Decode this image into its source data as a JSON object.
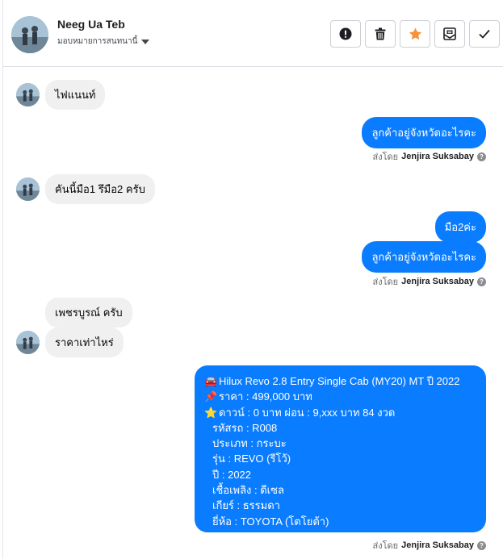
{
  "header": {
    "contact_name": "Neeg Ua Teb",
    "assign_label": "มอบหมายการสนทนานี้",
    "actions": [
      {
        "name": "report-icon"
      },
      {
        "name": "trash-icon"
      },
      {
        "name": "star-icon"
      },
      {
        "name": "mark-unread-icon"
      },
      {
        "name": "check-icon"
      }
    ]
  },
  "messages": {
    "m1": "ไฟแนนท์",
    "m2": "ลูกค้าอยู่จังหวัดอะไรคะ",
    "m3": "คันนี้มือ1 รึมือ2 ครับ",
    "m4": "มือ2ค่ะ",
    "m5": "ลูกค้าอยู่จังหวัดอะไรคะ",
    "m6": "เพชรบูรณ์ ครับ",
    "m7": "ราคาเท่าไหร่",
    "listing": {
      "line1_emoji": "🚘",
      "line1": "Hilux Revo 2.8 Entry Single Cab (MY20) MT ปี 2022",
      "line2_emoji": "📌",
      "line2": "ราคา : 499,000 บาท",
      "line3_emoji": "⭐",
      "line3": "ดาวน์ : 0 บาท ผ่อน : 9,xxx บาท 84 งวด",
      "line4": "รหัสรถ : R008",
      "line5": "ประเภท : กระบะ",
      "line6": "รุ่น : REVO (รีโว้)",
      "line7": "ปี : 2022",
      "line8": "เชื้อเพลิง : ดีเซล",
      "line9": "เกียร์ : ธรรมดา",
      "line10": "ยี่ห้อ : TOYOTA (โตโยต้า)"
    }
  },
  "sent_by": {
    "prefix": "ส่งโดย",
    "name": "Jenjira Suksabay",
    "help": "?"
  },
  "colors": {
    "outgoing": "#0a7cff",
    "incoming": "#f0f0f0",
    "star": "#f7923a"
  }
}
